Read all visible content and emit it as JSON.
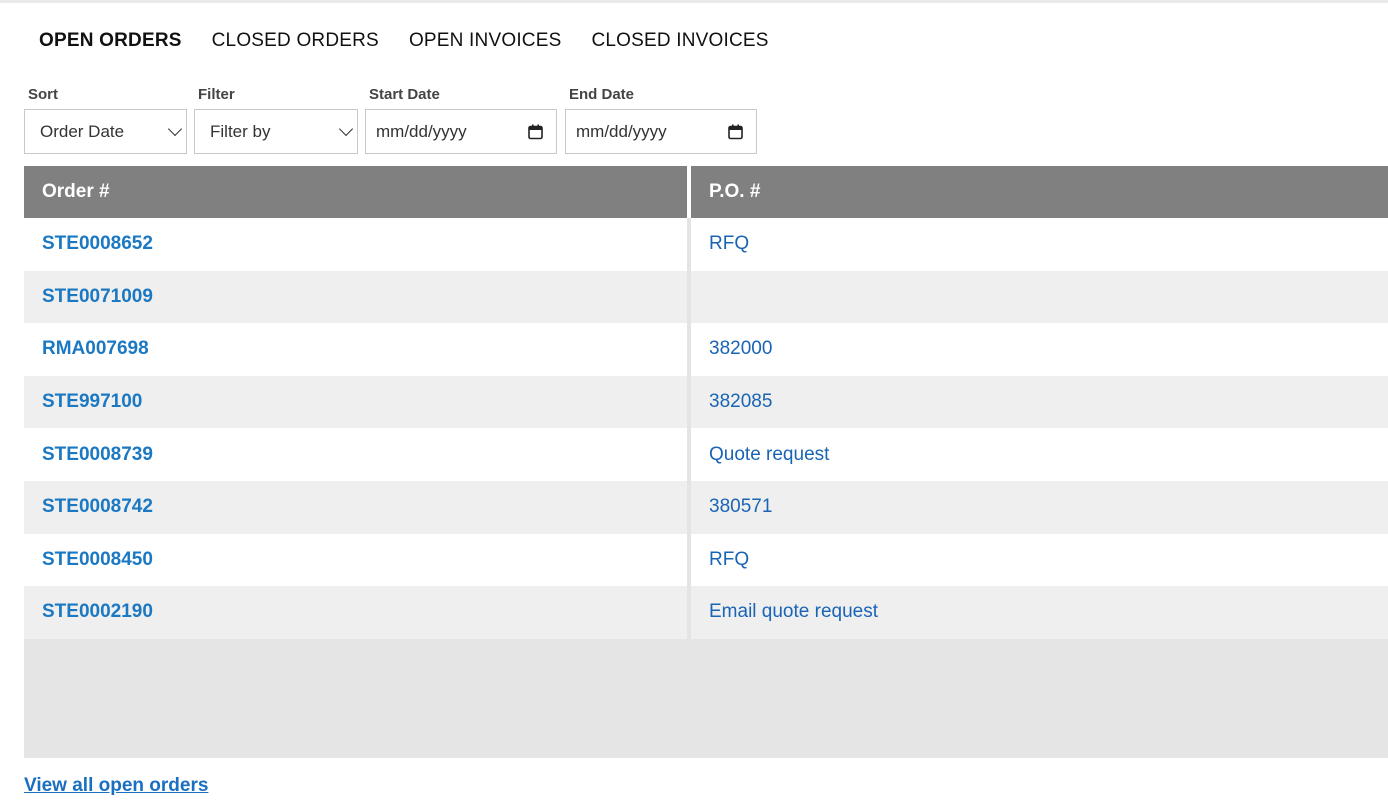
{
  "tabs": [
    {
      "label": "OPEN ORDERS",
      "active": true
    },
    {
      "label": "CLOSED ORDERS",
      "active": false
    },
    {
      "label": "OPEN INVOICES",
      "active": false
    },
    {
      "label": "CLOSED INVOICES",
      "active": false
    }
  ],
  "filters": {
    "sort": {
      "label": "Sort",
      "value": "Order Date"
    },
    "filter": {
      "label": "Filter",
      "value": "Filter by"
    },
    "start_date": {
      "label": "Start Date",
      "value": "mm/dd/yyyy"
    },
    "end_date": {
      "label": "End Date",
      "value": "mm/dd/yyyy"
    }
  },
  "table": {
    "headers": {
      "order": "Order #",
      "po": "P.O. #"
    },
    "rows": [
      {
        "order": "STE0008652",
        "po": "RFQ"
      },
      {
        "order": "STE0071009",
        "po": ""
      },
      {
        "order": "RMA007698",
        "po": "382000"
      },
      {
        "order": "STE997100",
        "po": "382085"
      },
      {
        "order": "STE0008739",
        "po": "Quote request"
      },
      {
        "order": "STE0008742",
        "po": "380571"
      },
      {
        "order": "STE0008450",
        "po": "RFQ"
      },
      {
        "order": "STE0002190",
        "po": "Email quote request"
      }
    ]
  },
  "footer": {
    "view_all_label": "View all open orders"
  },
  "colors": {
    "header_bg": "#808080",
    "link": "#1b78c2",
    "row_alt": "#efefef"
  }
}
